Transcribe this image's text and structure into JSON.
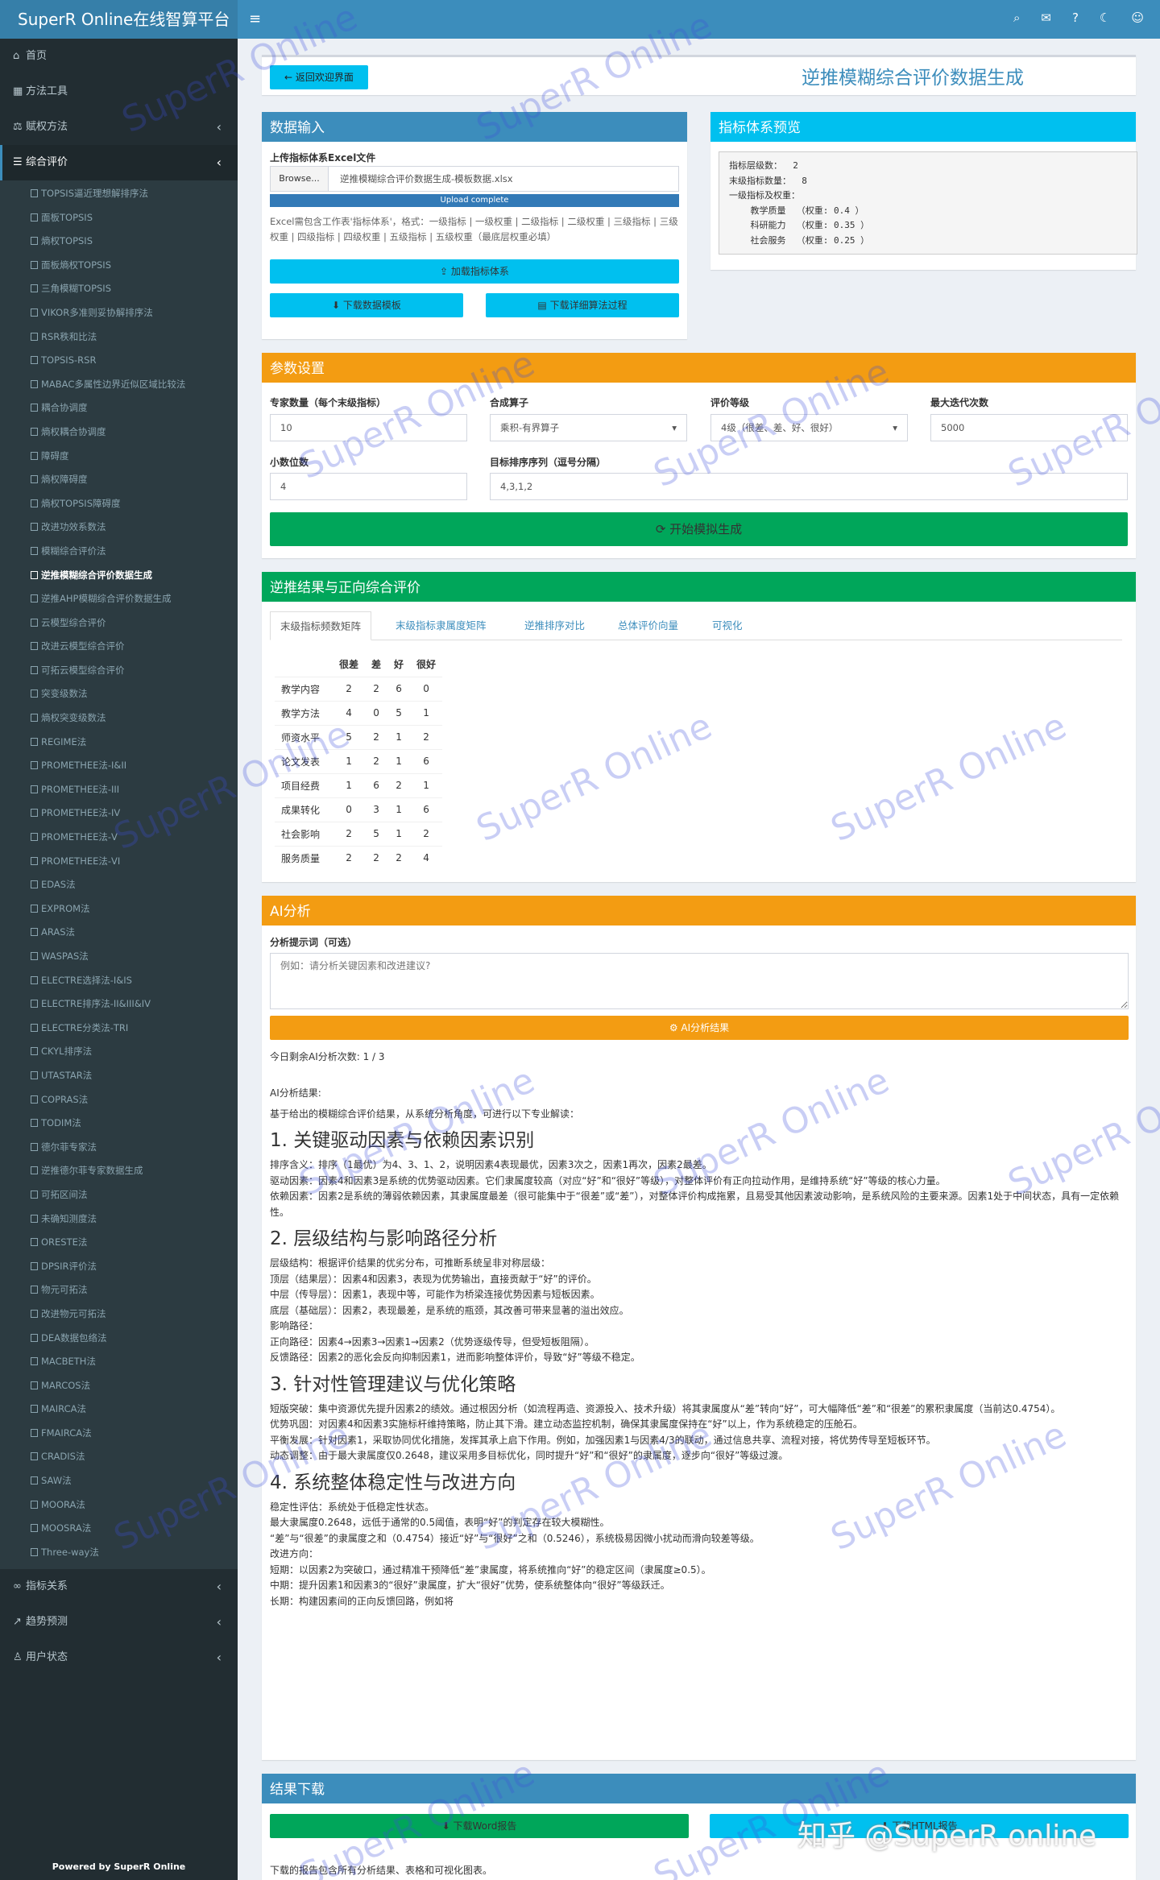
{
  "brand": "SuperR Online在线智算平台",
  "topbar": {
    "icons": [
      "search-icon",
      "megaphone-icon",
      "help-icon",
      "moon-icon",
      "user-comment-icon"
    ]
  },
  "nav": {
    "home": "首页",
    "tools": "方法工具",
    "weighting": "赋权方法",
    "comprehensive": "综合评价",
    "relation": "指标关系",
    "trend": "趋势预测",
    "user": "用户状态",
    "sub": [
      "TOPSIS逼近理想解排序法",
      "面板TOPSIS",
      "熵权TOPSIS",
      "面板熵权TOPSIS",
      "三角模糊TOPSIS",
      "VIKOR多准则妥协解排序法",
      "RSR秩和比法",
      "TOPSIS-RSR",
      "MABAC多属性边界近似区域比较法",
      "耦合协调度",
      "熵权耦合协调度",
      "障碍度",
      "熵权障碍度",
      "熵权TOPSIS障碍度",
      "改进功效系数法",
      "模糊综合评价法",
      "逆推模糊综合评价数据生成",
      "逆推AHP模糊综合评价数据生成",
      "云模型综合评价",
      "改进云模型综合评价",
      "可拓云模型综合评价",
      "突变级数法",
      "熵权突变级数法",
      "REGIME法",
      "PROMETHEE法-I&II",
      "PROMETHEE法-III",
      "PROMETHEE法-IV",
      "PROMETHEE法-V",
      "PROMETHEE法-VI",
      "EDAS法",
      "EXPROM法",
      "ARAS法",
      "WASPAS法",
      "ELECTRE选择法-I&IS",
      "ELECTRE排序法-II&III&IV",
      "ELECTRE分类法-TRI",
      "CKYL排序法",
      "UTASTAR法",
      "COPRAS法",
      "TODIM法",
      "德尔菲专家法",
      "逆推德尔菲专家数据生成",
      "可拓区间法",
      "未确知测度法",
      "ORESTE法",
      "DPSIR评价法",
      "物元可拓法",
      "改进物元可拓法",
      "DEA数据包络法",
      "MACBETH法",
      "MARCOS法",
      "MAIRCA法",
      "FMAIRCA法",
      "CRADIS法",
      "SAW法",
      "MOORA法",
      "MOOSRA法",
      "Three-way法"
    ],
    "active_index": 16,
    "powered": "Powered by SuperR Online"
  },
  "header": {
    "back_label": "返回欢迎界面",
    "title": "逆推模糊综合评价数据生成"
  },
  "input": {
    "title": "数据输入",
    "upload_label": "上传指标体系Excel文件",
    "browse": "Browse...",
    "filename": "逆推模糊综合评价数据生成-模板数据.xlsx",
    "progress": "Upload complete",
    "progress_pct": 100,
    "hint": "Excel需包含工作表'指标体系'，格式：一级指标 | 一级权重 | 二级指标 | 二级权重 | 三级指标 | 三级权重 | 四级指标 | 四级权重 | 五级指标 | 五级权重（最底层权重必填）",
    "load_btn": "加载指标体系",
    "download_tpl": "下载数据模板",
    "download_algo": "下载详细算法过程"
  },
  "preview": {
    "title": "指标体系预览",
    "lines": [
      "指标层级数：  2",
      "末级指标数量：  8",
      "一级指标及权重：",
      "    教学质量  （权重: 0.4 ）",
      "    科研能力  （权重: 0.35 ）",
      "    社会服务  （权重: 0.25 ）"
    ]
  },
  "params": {
    "title": "参数设置",
    "expert_label": "专家数量（每个末级指标）",
    "expert_value": "10",
    "operator_label": "合成算子",
    "operator_value": "乘积-有界算子",
    "grade_label": "评价等级",
    "grade_value": "4级（很差、差、好、很好）",
    "iter_label": "最大迭代次数",
    "iter_value": "5000",
    "decimal_label": "小数位数",
    "decimal_value": "4",
    "target_label": "目标排序序列（逗号分隔）",
    "target_value": "4,3,1,2",
    "start_btn": "开始模拟生成"
  },
  "results": {
    "title": "逆推结果与正向综合评价",
    "tabs": [
      "末级指标频数矩阵",
      "末级指标隶属度矩阵",
      "逆推排序对比",
      "总体评价向量",
      "可视化"
    ],
    "columns": [
      "",
      "很差",
      "差",
      "好",
      "很好"
    ],
    "rows": [
      [
        "教学内容",
        "2",
        "2",
        "6",
        "0"
      ],
      [
        "教学方法",
        "4",
        "0",
        "5",
        "1"
      ],
      [
        "师资水平",
        "5",
        "2",
        "1",
        "2"
      ],
      [
        "论文发表",
        "1",
        "2",
        "1",
        "6"
      ],
      [
        "项目经费",
        "1",
        "6",
        "2",
        "1"
      ],
      [
        "成果转化",
        "0",
        "3",
        "1",
        "6"
      ],
      [
        "社会影响",
        "2",
        "5",
        "1",
        "2"
      ],
      [
        "服务质量",
        "2",
        "2",
        "2",
        "4"
      ]
    ]
  },
  "ai": {
    "title": "AI分析",
    "prompt_label": "分析提示词（可选）",
    "prompt_placeholder": "例如：请分析关键因素和改进建议?",
    "btn": "AI分析结果",
    "remaining": "今日剩余AI分析次数: 1 / 3",
    "result_label": "AI分析结果:",
    "intro": "基于给出的模糊综合评价结果，从系统分析角度，可进行以下专业解读：",
    "sections": [
      {
        "h": "1. 关键驱动因素与依赖因素识别",
        "lines": [
          "排序含义：排序（1最优）为4、3、1、2，说明因素4表现最优，因素3次之，因素1再次，因素2最差。",
          "驱动因素：因素4和因素3是系统的优势驱动因素。它们隶属度较高（对应“好”和“很好”等级），对整体评价有正向拉动作用，是维持系统“好”等级的核心力量。",
          "依赖因素：因素2是系统的薄弱依赖因素，其隶属度最差（很可能集中于“很差”或“差”），对整体评价构成拖累，且易受其他因素波动影响，是系统风险的主要来源。因素1处于中间状态，具有一定依赖性。"
        ]
      },
      {
        "h": "2. 层级结构与影响路径分析",
        "lines": [
          "层级结构：根据评价结果的优劣分布，可推断系统呈非对称层级：",
          "顶层（结果层）：因素4和因素3，表现为优势输出，直接贡献于“好”的评价。",
          "中层（传导层）：因素1，表现中等，可能作为桥梁连接优势因素与短板因素。",
          "底层（基础层）：因素2，表现最差，是系统的瓶颈，其改善可带来显著的溢出效应。",
          "影响路径：",
          "正向路径：因素4→因素3→因素1→因素2（优势逐级传导，但受短板阻隔）。",
          "反馈路径：因素2的恶化会反向抑制因素1，进而影响整体评价，导致“好”等级不稳定。"
        ]
      },
      {
        "h": "3. 针对性管理建议与优化策略",
        "lines": [
          "短版突破：集中资源优先提升因素2的绩效。通过根因分析（如流程再造、资源投入、技术升级）将其隶属度从“差”转向“好”，可大幅降低“差”和“很差”的累积隶属度（当前达0.4754）。",
          "优势巩固：对因素4和因素3实施标杆维持策略，防止其下滑。建立动态监控机制，确保其隶属度保持在“好”以上，作为系统稳定的压舱石。",
          "平衡发展：针对因素1，采取协同优化措施，发挥其承上启下作用。例如，加强因素1与因素4/3的联动，通过信息共享、流程对接，将优势传导至短板环节。",
          "动态调整：由于最大隶属度仅0.2648，建议采用多目标优化，同时提升“好”和“很好”的隶属度，逐步向“很好”等级过渡。"
        ]
      },
      {
        "h": "4. 系统整体稳定性与改进方向",
        "lines": [
          "稳定性评估：系统处于低稳定性状态。",
          "最大隶属度0.2648，远低于通常的0.5阈值，表明“好”的判定存在较大模糊性。",
          "“差”与“很差”的隶属度之和（0.4754）接近“好”与“很好”之和（0.5246），系统极易因微小扰动而滑向较差等级。",
          "改进方向：",
          "短期：以因素2为突破口，通过精准干预降低“差”隶属度，将系统推向“好”的稳定区间（隶属度≥0.5）。",
          "中期：提升因素1和因素3的“很好”隶属度，扩大“很好”优势，使系统整体向“很好”等级跃迁。",
          "长期：构建因素间的正向反馈回路，例如将"
        ]
      }
    ]
  },
  "download": {
    "title": "结果下载",
    "word_btn": "下载Word报告",
    "html_btn": "下载HTML报告",
    "note": "下载的报告包含所有分析结果、表格和可视化图表。"
  },
  "watermark": "SuperR Online",
  "zhihu": "知乎 @SuperR online",
  "colors": {
    "primary": "#3c8dbc",
    "info": "#00c0ef",
    "warning": "#f39c12",
    "success": "#00a65a",
    "sidebar": "#222d32"
  }
}
